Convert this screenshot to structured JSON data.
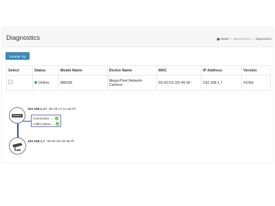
{
  "page": {
    "title": "Diagnostics",
    "breadcrumb": {
      "home": "Home",
      "parent": "Maintenance",
      "current": "Diagnostics",
      "separator": ">"
    }
  },
  "actions": {
    "another_try": "Another Try"
  },
  "table": {
    "headers": [
      "Select",
      "Status",
      "Model Name",
      "Device Name",
      "MAC",
      "IP Address",
      "Version"
    ],
    "rows": [
      {
        "status": "Online",
        "model": "IB8168",
        "device_line1": "Mega-Pixel Network",
        "device_line2": "Camera",
        "mac": "00-02-D1-2D-45-0F",
        "ip": "192.168.1.7",
        "version": "0100e"
      }
    ]
  },
  "topology": {
    "switch": {
      "ip": "192.168.1.17",
      "mac": "00-40-c7-1c-a2-07",
      "icon": "switch-icon"
    },
    "status": {
      "connection": "Connection......",
      "cable": "Cable status....."
    },
    "camera": {
      "ip": "192.168.1.7",
      "mac": "00-02-d1-2d-45-0f",
      "icon": "camera-icon"
    }
  },
  "colors": {
    "primary": "#3c8dbc",
    "online": "#3cb034",
    "link": "#2f47a8"
  }
}
